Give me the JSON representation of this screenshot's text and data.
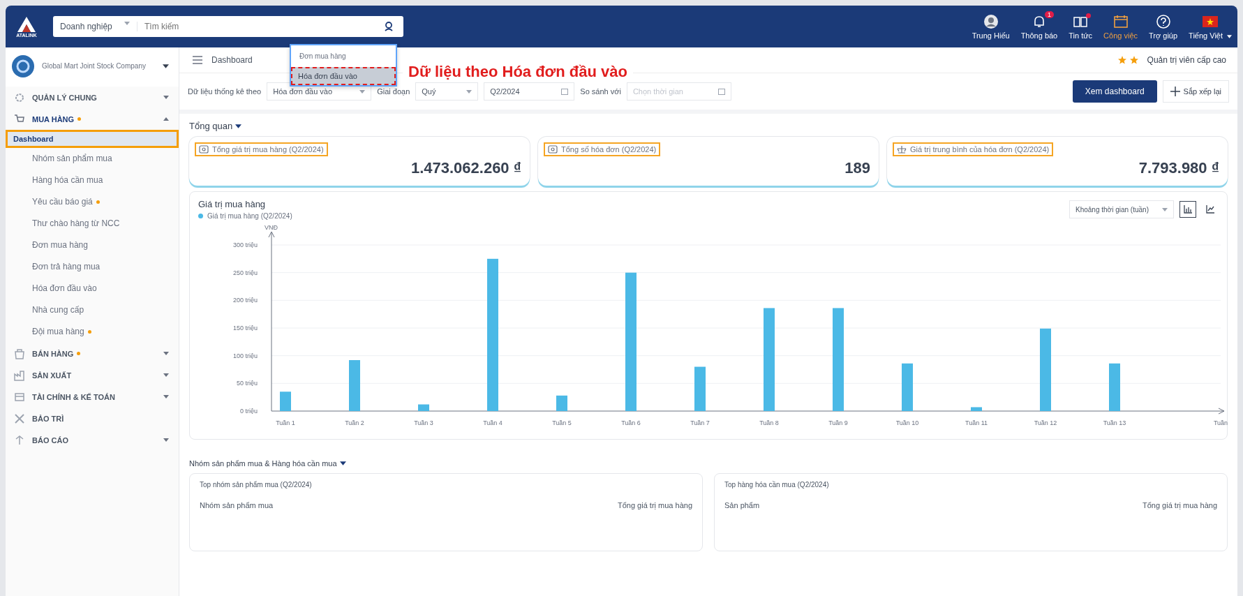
{
  "header": {
    "logo_text": "ATALINK",
    "scope_select": "Doanh nghiệp",
    "search_placeholder": "Tìm kiếm",
    "actions": [
      {
        "kind": "avatar",
        "label": "Trung Hiếu",
        "selected": false,
        "dot": false
      },
      {
        "kind": "bell",
        "label": "Thông báo",
        "selected": false,
        "badge": "1",
        "dot": false
      },
      {
        "kind": "news",
        "label": "Tin tức",
        "selected": false,
        "dot": true
      },
      {
        "kind": "tasks",
        "label": "Công việc",
        "selected": true,
        "dot": false
      },
      {
        "kind": "help",
        "label": "Trợ giúp",
        "selected": false,
        "dot": false
      },
      {
        "kind": "flag",
        "label": "Tiếng Việt",
        "selected": false,
        "dot": false
      }
    ]
  },
  "sidebar": {
    "company": "Global Mart Joint Stock Company",
    "sections": [
      {
        "kind": "gear",
        "label": "QUẢN LÝ CHUNG",
        "dot": false,
        "expanded": false,
        "has_caret": true
      },
      {
        "kind": "cart",
        "label": "MUA HÀNG",
        "dot": true,
        "expanded": true,
        "has_caret": true,
        "children": [
          {
            "label": "Dashboard",
            "selected": true,
            "highlighted": true,
            "dot": false
          },
          {
            "label": "Nhóm sản phẩm mua",
            "selected": false,
            "highlighted": false,
            "dot": false
          },
          {
            "label": "Hàng hóa cần mua",
            "selected": false,
            "highlighted": false,
            "dot": false
          },
          {
            "label": "Yêu cầu báo giá",
            "selected": false,
            "highlighted": false,
            "dot": true
          },
          {
            "label": "Thư chào hàng từ NCC",
            "selected": false,
            "highlighted": false,
            "dot": false
          },
          {
            "label": "Đơn mua hàng",
            "selected": false,
            "highlighted": false,
            "dot": false
          },
          {
            "label": "Đơn trả hàng mua",
            "selected": false,
            "highlighted": false,
            "dot": false
          },
          {
            "label": "Hóa đơn đầu vào",
            "selected": false,
            "highlighted": false,
            "dot": false
          },
          {
            "label": "Nhà cung cấp",
            "selected": false,
            "highlighted": false,
            "dot": false
          },
          {
            "label": "Đội mua hàng",
            "selected": false,
            "highlighted": false,
            "dot": true
          }
        ]
      },
      {
        "kind": "shop",
        "label": "BÁN HÀNG",
        "dot": true,
        "expanded": false,
        "has_caret": true
      },
      {
        "kind": "factory",
        "label": "SẢN XUẤT",
        "dot": false,
        "expanded": false,
        "has_caret": true
      },
      {
        "kind": "money",
        "label": "TÀI CHÍNH & KẾ TOÁN",
        "dot": false,
        "expanded": false,
        "has_caret": true
      },
      {
        "kind": "tools",
        "label": "BẢO TRÌ",
        "dot": false,
        "expanded": false,
        "has_caret": false
      },
      {
        "kind": "report",
        "label": "BÁO CÁO",
        "dot": false,
        "expanded": false,
        "has_caret": true
      }
    ]
  },
  "breadcrumb": "Dashboard",
  "role": {
    "label": "Quản trị viên cấp cao"
  },
  "dropdown": {
    "options": [
      {
        "label": "Đơn mua hàng",
        "selected": false
      },
      {
        "label": "Hóa đơn đầu vào",
        "selected": true
      }
    ]
  },
  "annotation": "Dữ liệu theo Hóa đơn đầu vào",
  "filters": {
    "data_label": "Dữ liệu thống kê theo",
    "data_value": "Hóa đơn đầu vào",
    "period_label": "Giai đoạn",
    "period_value": "Quý",
    "date_value": "Q2/2024",
    "compare_label": "So sánh với",
    "compare_placeholder": "Chọn thời gian",
    "view_button": "Xem dashboard",
    "rearrange_button": "Sắp xếp lại"
  },
  "overview": {
    "title": "Tổng quan",
    "cards": [
      {
        "kind": "money",
        "title": "Tổng giá trị mua hàng (Q2/2024)",
        "value": "1.473.062.260 ₫",
        "highlighted": true
      },
      {
        "kind": "invoice",
        "title": "Tổng số hóa đơn (Q2/2024)",
        "value": "189",
        "highlighted": true
      },
      {
        "kind": "scale",
        "title": "Giá trị trung bình của hóa đơn (Q2/2024)",
        "value": "7.793.980 ₫",
        "highlighted": true
      }
    ]
  },
  "purchase_chart": {
    "title": "Giá trị mua hàng",
    "interval_select": "Khoảng thời gian (tuần)",
    "view_toggle": [
      {
        "kind": "bar",
        "selected": true
      },
      {
        "kind": "line",
        "selected": false
      }
    ],
    "chart_data": {
      "type": "bar",
      "ylabel": "VNĐ",
      "annotations": [
        {
          "text": "Tuần"
        }
      ],
      "grid": true,
      "categories": [
        "Tuần 1",
        "Tuần 2",
        "Tuần 3",
        "Tuần 4",
        "Tuần 5",
        "Tuần 6",
        "Tuần 7",
        "Tuần 8",
        "Tuần 9",
        "Tuần 10",
        "Tuần 11",
        "Tuần 12",
        "Tuần 13"
      ],
      "series": [
        {
          "name": "Giá trị mua hàng (Q2/2024)",
          "color": "#4bb9e6",
          "values": [
            35,
            92,
            12,
            275,
            28,
            250,
            80,
            186,
            186,
            86,
            7,
            149,
            86
          ]
        }
      ],
      "ylim": [
        0,
        300
      ],
      "yticks": [
        {
          "value": 0,
          "label": "0 triệu"
        },
        {
          "value": 50,
          "label": "50 triệu"
        },
        {
          "value": 100,
          "label": "100 triệu"
        },
        {
          "value": 150,
          "label": "150 triệu"
        },
        {
          "value": 200,
          "label": "200 triệu"
        },
        {
          "value": 250,
          "label": "250 triệu"
        },
        {
          "value": 300,
          "label": "300 triệu"
        }
      ]
    }
  },
  "groups_section": {
    "title": "Nhóm sản phẩm mua & Hàng hóa cần mua",
    "panels": [
      {
        "title": "Top nhóm sản phẩm mua (Q2/2024)",
        "columns": [
          "Nhóm sản phẩm mua",
          "Tổng giá trị mua hàng"
        ]
      },
      {
        "title": "Top hàng hóa cần mua (Q2/2024)",
        "columns": [
          "Sản phẩm",
          "Tổng giá trị mua hàng"
        ]
      }
    ]
  }
}
